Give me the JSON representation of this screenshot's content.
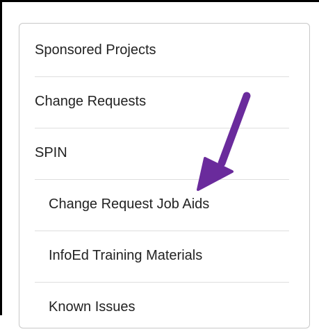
{
  "menu": {
    "items": [
      {
        "label": "Sponsored Projects",
        "level": 1
      },
      {
        "label": "Change Requests",
        "level": 1
      },
      {
        "label": "SPIN",
        "level": 1
      },
      {
        "label": "Change Request Job Aids",
        "level": 2
      },
      {
        "label": "InfoEd Training Materials",
        "level": 2
      },
      {
        "label": "Known Issues",
        "level": 2
      }
    ]
  },
  "annotation": {
    "arrow_color": "#6a2b9c",
    "icon": "arrow-pointer-icon"
  }
}
